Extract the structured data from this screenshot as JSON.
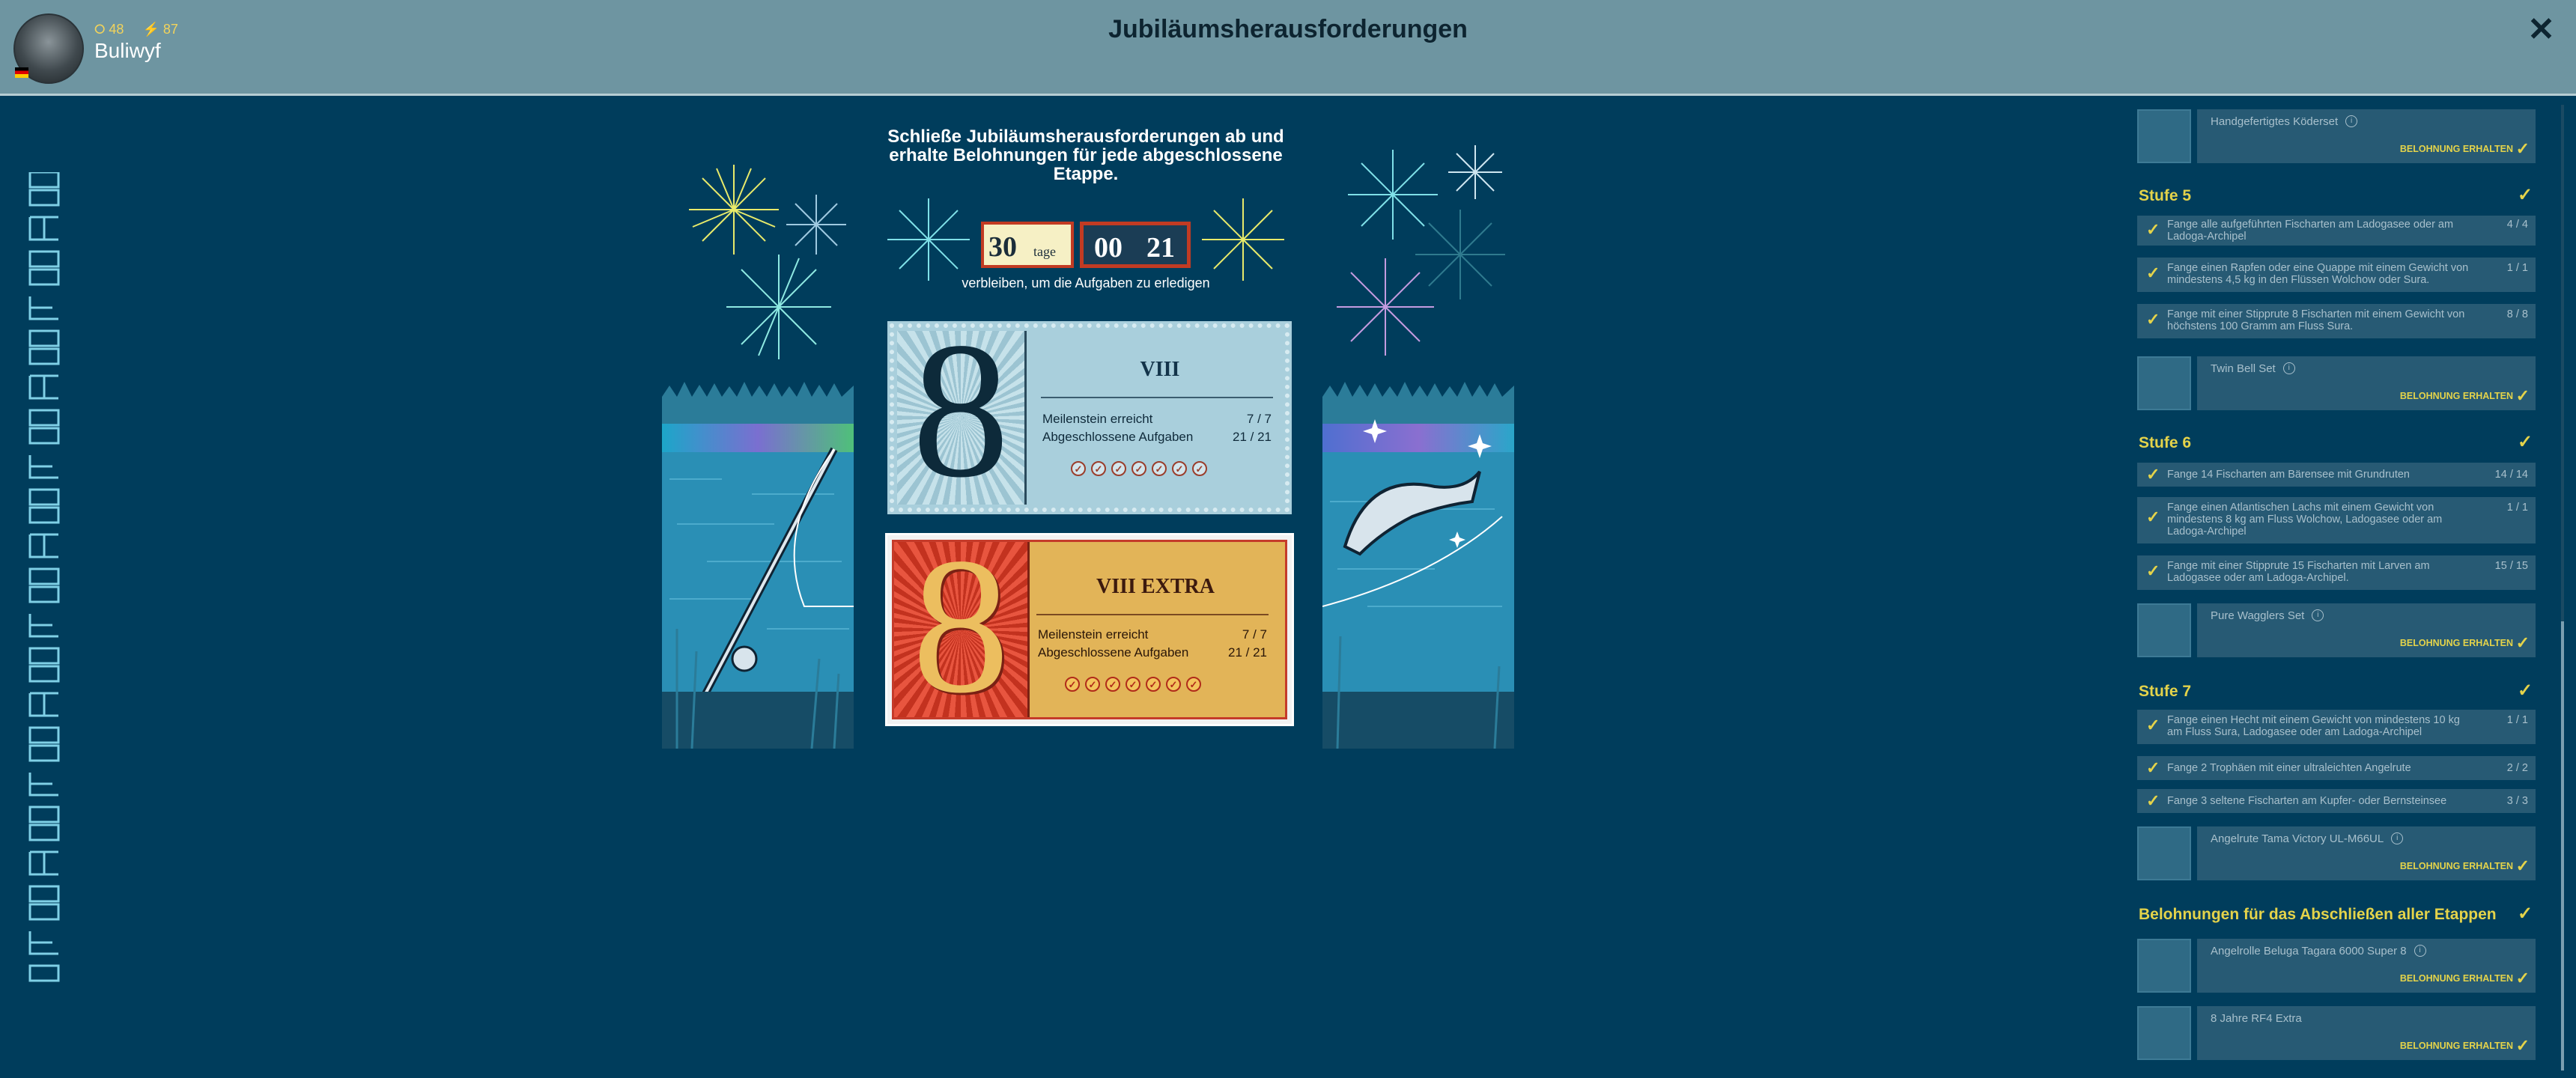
{
  "header": {
    "title": "Jubiläumsherausforderungen",
    "username": "Buliwyf",
    "stat1": "48",
    "stat2": "87",
    "close": "✕"
  },
  "intro": {
    "text": "Schließe Jubiläumsherausforderungen ab und erhalte Belohnungen für jede abgeschlossene Etappe.",
    "days": "30",
    "days_unit": "tage",
    "hours": "00",
    "minutes": "21",
    "remaining": "verbleiben, um die Aufgaben zu erledigen"
  },
  "cards": [
    {
      "number": "8",
      "title": "VIII",
      "milestone_label": "Meilenstein erreicht",
      "milestone_value": "7 / 7",
      "tasks_label": "Abgeschlossene Aufgaben",
      "tasks_value": "21 / 21",
      "checks": 7
    },
    {
      "number": "8",
      "title": "VIII EXTRA",
      "milestone_label": "Meilenstein erreicht",
      "milestone_value": "7 / 7",
      "tasks_label": "Abgeschlossene Aufgaben",
      "tasks_value": "21 / 21",
      "checks": 7
    }
  ],
  "colors": {
    "accent": "#e4d34a",
    "background": "#003d5c",
    "header": "#6e95a1"
  },
  "right": {
    "top_reward": {
      "name": "Handgefertigtes Köderset",
      "button": "BELOHNUNG ERHALTEN"
    },
    "stage5": {
      "title": "Stufe 5",
      "tasks": [
        {
          "text": "Fange alle aufgeführten Fischarten am Ladogasee oder am Ladoga-Archipel",
          "progress": "4 / 4"
        },
        {
          "text": "Fange einen Rapfen oder eine Quappe mit einem Gewicht von mindestens 4,5 kg in den Flüssen Wolchow oder Sura.",
          "progress": "1 / 1"
        },
        {
          "text": "Fange mit einer Stipprute 8 Fischarten mit einem Gewicht von höchstens 100 Gramm am Fluss Sura.",
          "progress": "8 / 8"
        }
      ],
      "reward": {
        "name": "Twin Bell Set",
        "button": "BELOHNUNG ERHALTEN"
      }
    },
    "stage6": {
      "title": "Stufe 6",
      "tasks": [
        {
          "text": "Fange 14 Fischarten am Bärensee mit Grundruten",
          "progress": "14 / 14"
        },
        {
          "text": "Fange einen Atlantischen Lachs mit einem Gewicht von mindestens 8 kg am Fluss Wolchow, Ladogasee oder am Ladoga-Archipel",
          "progress": "1 / 1"
        },
        {
          "text": "Fange mit einer Stipprute 15 Fischarten mit Larven am Ladogasee oder am Ladoga-Archipel.",
          "progress": "15 / 15"
        }
      ],
      "reward": {
        "name": "Pure Wagglers Set",
        "button": "BELOHNUNG ERHALTEN"
      }
    },
    "stage7": {
      "title": "Stufe 7",
      "tasks": [
        {
          "text": "Fange einen Hecht mit einem Gewicht von mindestens 10 kg am Fluss Sura, Ladogasee oder am Ladoga-Archipel",
          "progress": "1 / 1"
        },
        {
          "text": "Fange 2 Trophäen mit einer ultraleichten Angelrute",
          "progress": "2 / 2"
        },
        {
          "text": "Fange 3 seltene Fischarten am Kupfer- oder Bernsteinsee",
          "progress": "3 / 3"
        }
      ],
      "reward": {
        "name": "Angelrute Tama Victory UL-M66UL",
        "button": "BELOHNUNG ERHALTEN"
      }
    },
    "all": {
      "title": "Belohnungen für das Abschließen aller Etappen",
      "reward1": {
        "name": "Angelrolle Beluga Tagara 6000 Super 8",
        "button": "BELOHNUNG ERHALTEN"
      },
      "reward2": {
        "name": "8 Jahre RF4 Extra",
        "button": "BELOHNUNG ERHALTEN"
      }
    }
  }
}
